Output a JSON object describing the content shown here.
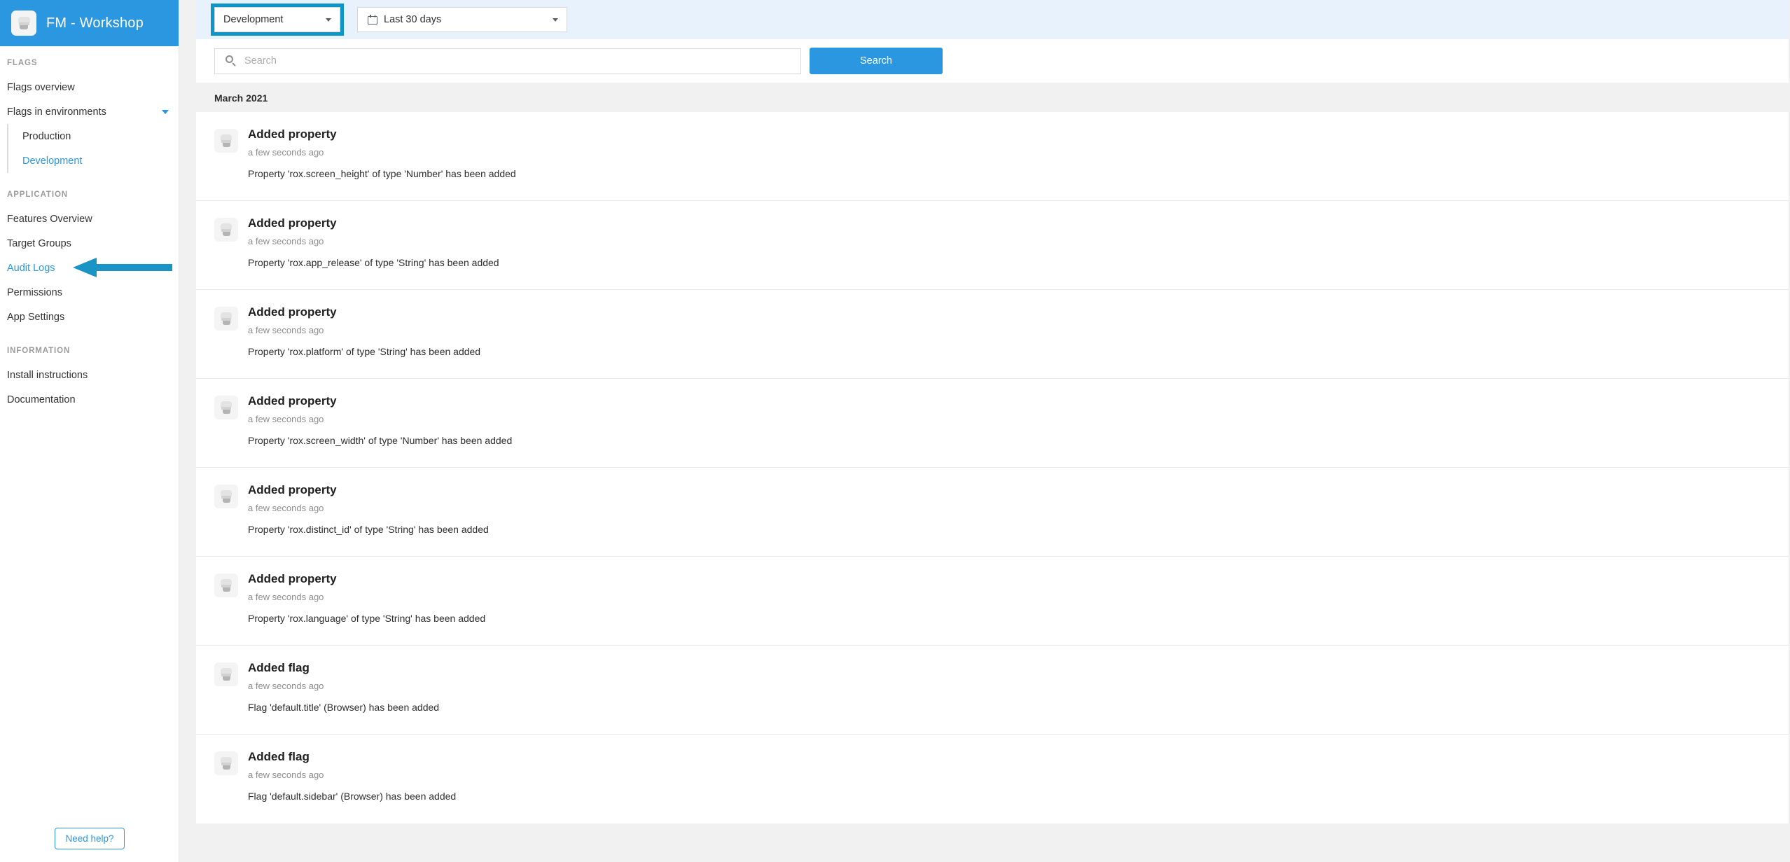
{
  "app": {
    "title": "FM - Workshop",
    "logo_icon": "bucket-icon",
    "brand_color": "#2b97e0"
  },
  "sidebar": {
    "sections": [
      {
        "label": "FLAGS",
        "items": [
          {
            "label": "Flags overview",
            "type": "item",
            "active": false
          },
          {
            "label": "Flags in environments",
            "type": "expandable",
            "icon": "chevron-down-icon",
            "expanded": true
          }
        ],
        "subitems": [
          {
            "label": "Production",
            "active": false
          },
          {
            "label": "Development",
            "active": true
          }
        ]
      },
      {
        "label": "APPLICATION",
        "items": [
          {
            "label": "Features Overview",
            "active": false
          },
          {
            "label": "Target Groups",
            "active": false
          },
          {
            "label": "Audit Logs",
            "active": true
          },
          {
            "label": "Permissions",
            "active": false
          },
          {
            "label": "App Settings",
            "active": false
          }
        ]
      },
      {
        "label": "INFORMATION",
        "items": [
          {
            "label": "Install instructions",
            "active": false
          },
          {
            "label": "Documentation",
            "active": false
          }
        ]
      }
    ],
    "need_help_label": "Need help?"
  },
  "toolbar": {
    "environment_select": {
      "value": "Development",
      "icon": "chevron-down-icon",
      "highlighted": true,
      "highlight_color": "#0d95c8"
    },
    "date_select": {
      "value": "Last 30 days",
      "leading_icon": "calendar-icon",
      "icon": "chevron-down-icon"
    }
  },
  "search": {
    "placeholder": "Search",
    "value": "",
    "icon": "search-icon",
    "button_label": "Search"
  },
  "main": {
    "month_header": "March 2021",
    "entries": [
      {
        "icon": "bucket-icon",
        "title": "Added property",
        "time": "a few seconds ago",
        "description": "Property 'rox.screen_height' of type 'Number' has been added"
      },
      {
        "icon": "bucket-icon",
        "title": "Added property",
        "time": "a few seconds ago",
        "description": "Property 'rox.app_release' of type 'String' has been added"
      },
      {
        "icon": "bucket-icon",
        "title": "Added property",
        "time": "a few seconds ago",
        "description": "Property 'rox.platform' of type 'String' has been added"
      },
      {
        "icon": "bucket-icon",
        "title": "Added property",
        "time": "a few seconds ago",
        "description": "Property 'rox.screen_width' of type 'Number' has been added"
      },
      {
        "icon": "bucket-icon",
        "title": "Added property",
        "time": "a few seconds ago",
        "description": "Property 'rox.distinct_id' of type 'String' has been added"
      },
      {
        "icon": "bucket-icon",
        "title": "Added property",
        "time": "a few seconds ago",
        "description": "Property 'rox.language' of type 'String' has been added"
      },
      {
        "icon": "bucket-icon",
        "title": "Added flag",
        "time": "a few seconds ago",
        "description": "Flag 'default.title' (Browser) has been added"
      },
      {
        "icon": "bucket-icon",
        "title": "Added flag",
        "time": "a few seconds ago",
        "description": "Flag 'default.sidebar' (Browser) has been added"
      }
    ]
  },
  "annotation": {
    "type": "arrow-left",
    "color": "#1a94c4",
    "points_to": "Audit Logs"
  }
}
